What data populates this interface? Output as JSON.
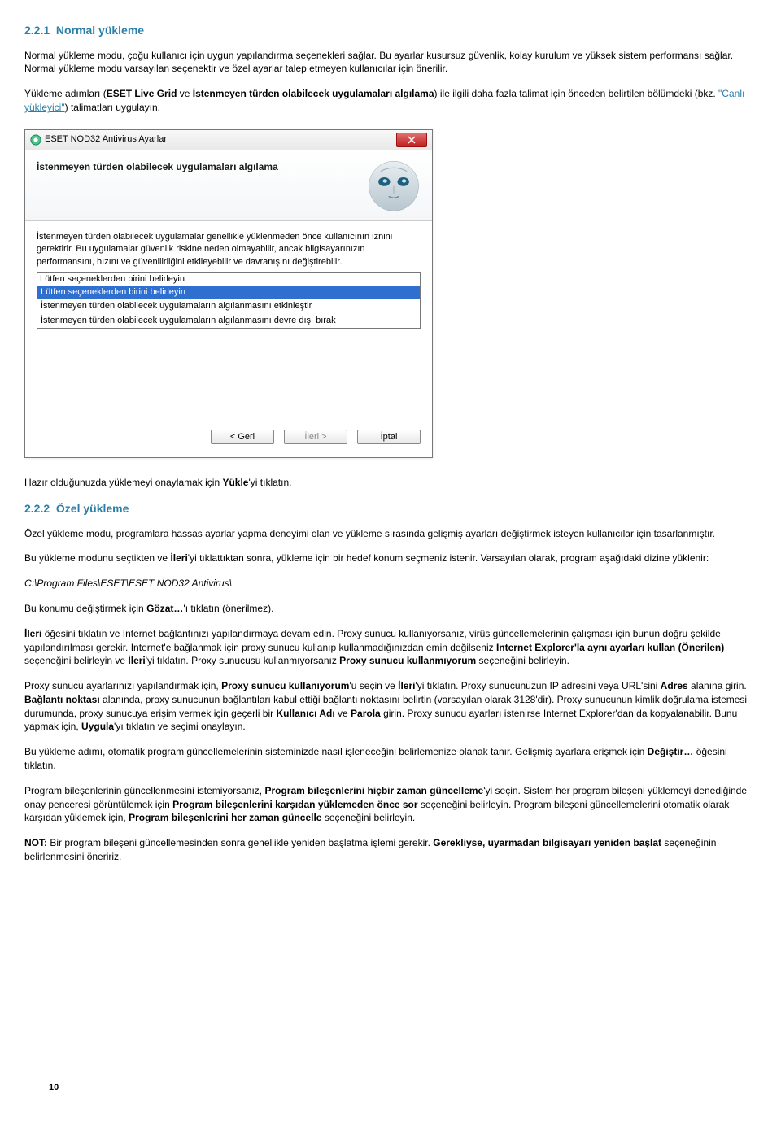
{
  "section1": {
    "number": "2.2.1",
    "title": "Normal yükleme",
    "p1_a": "Normal yükleme modu, çoğu kullanıcı için uygun yapılandırma seçenekleri sağlar. Bu ayarlar kusursuz güvenlik, kolay kurulum ve yüksek sistem performansı sağlar. Normal yükleme modu varsayılan seçenektir ve özel ayarlar talep etmeyen kullanıcılar için önerilir.",
    "p1_b1": "Yükleme adımları (",
    "p1_b_strong1": "ESET Live Grid",
    "p1_b2": " ve ",
    "p1_b_strong2": "İstenmeyen türden olabilecek uygulamaları algılama",
    "p1_b3": ") ile ilgili daha fazla talimat için önceden belirtilen bölümdeki (bkz. ",
    "p1_b_link": "\"Canlı yükleyici\"",
    "p1_b4": ") talimatları uygulayın."
  },
  "dialog": {
    "window_title": "ESET NOD32 Antivirus Ayarları",
    "header": "İstenmeyen türden olabilecek uygulamaları algılama",
    "body": "İstenmeyen türden olabilecek uygulamalar genellikle yüklenmeden önce kullanıcının iznini gerektirir. Bu uygulamalar güvenlik riskine neden olmayabilir, ancak bilgisayarınızın performansını, hızını ve güvenilirliğini etkileyebilir ve davranışını değiştirebilir.",
    "select_value": "Lütfen seçeneklerden birini belirleyin",
    "opt1": "Lütfen seçeneklerden birini belirleyin",
    "opt2": "İstenmeyen türden olabilecek uygulamaların algılanmasını etkinleştir",
    "opt3": "İstenmeyen türden olabilecek uygulamaların algılanmasını devre dışı bırak",
    "btn_back": "< Geri",
    "btn_next": "İleri >",
    "btn_cancel": "İptal"
  },
  "mid": {
    "p1a": "Hazır olduğunuzda yüklemeyi onaylamak için ",
    "p1b": "Yükle",
    "p1c": "'yi tıklatın."
  },
  "section2": {
    "number": "2.2.2",
    "title": "Özel yükleme",
    "p1": "Özel yükleme modu, programlara hassas ayarlar yapma deneyimi olan ve yükleme sırasında gelişmiş ayarları değiştirmek isteyen kullanıcılar için tasarlanmıştır.",
    "p2a": "Bu yükleme modunu seçtikten ve ",
    "p2b": "İleri",
    "p2c": "'yi tıklattıktan sonra, yükleme için bir hedef konum seçmeniz istenir. Varsayılan olarak, program aşağıdaki dizine yüklenir:",
    "path": "C:\\Program Files\\ESET\\ESET NOD32 Antivirus\\",
    "p3a": "Bu konumu değiştirmek için ",
    "p3b": "Gözat…",
    "p3c": "'ı tıklatın (önerilmez).",
    "p4a": "İleri",
    "p4b": " öğesini tıklatın ve Internet bağlantınızı yapılandırmaya devam edin. Proxy sunucu kullanıyorsanız, virüs güncellemelerinin çalışması için bunun doğru şekilde yapılandırılması gerekir. Internet'e bağlanmak için proxy sunucu kullanıp kullanmadığınızdan emin değilseniz ",
    "p4c": "Internet Explorer'la aynı ayarları kullan (Önerilen)",
    "p4d": " seçeneğini belirleyin ve ",
    "p4e": "İleri",
    "p4f": "'yi tıklatın. Proxy sunucusu kullanmıyorsanız ",
    "p4g": "Proxy sunucu kullanmıyorum",
    "p4h": " seçeneğini belirleyin.",
    "p5a": "Proxy sunucu ayarlarınızı yapılandırmak için, ",
    "p5b": "Proxy sunucu kullanıyorum",
    "p5c": "'u seçin ve ",
    "p5d": "İleri",
    "p5e": "'yi tıklatın. Proxy sunucunuzun IP adresini veya URL'sini ",
    "p5f": "Adres",
    "p5g": " alanına girin. ",
    "p5h": "Bağlantı noktası",
    "p5i": " alanında, proxy sunucunun bağlantıları kabul ettiği bağlantı noktasını belirtin (varsayılan olarak 3128'dir). Proxy sunucunun kimlik doğrulama istemesi durumunda, proxy sunucuya erişim vermek için geçerli bir ",
    "p5j": "Kullanıcı Adı",
    "p5k": " ve ",
    "p5l": "Parola",
    "p5m": " girin. Proxy sunucu ayarları istenirse Internet Explorer'dan da kopyalanabilir. Bunu yapmak için, ",
    "p5n": "Uygula",
    "p5o": "'yı tıklatın ve seçimi onaylayın.",
    "p6a": "Bu yükleme adımı, otomatik program güncellemelerinin sisteminizde nasıl işleneceğini belirlemenize olanak tanır. Gelişmiş ayarlara erişmek için ",
    "p6b": "Değiştir…",
    "p6c": " öğesini tıklatın.",
    "p7a": "Program bileşenlerinin güncellenmesini istemiyorsanız, ",
    "p7b": "Program bileşenlerini hiçbir zaman güncelleme",
    "p7c": "'yi seçin. Sistem her program bileşeni yüklemeyi denediğinde onay penceresi görüntülemek için ",
    "p7d": "Program bileşenlerini karşıdan yüklemeden önce sor",
    "p7e": " seçeneğini belirleyin. Program bileşeni güncellemelerini otomatik olarak karşıdan yüklemek için, ",
    "p7f": "Program bileşenlerini her zaman güncelle",
    "p7g": " seçeneğini belirleyin.",
    "p8a": "NOT:",
    "p8b": " Bir program bileşeni güncellemesinden sonra genellikle yeniden başlatma işlemi gerekir. ",
    "p8c": "Gerekliyse, uyarmadan bilgisayarı yeniden başlat",
    "p8d": " seçeneğinin belirlenmesini öneririz."
  },
  "page_number": "10"
}
